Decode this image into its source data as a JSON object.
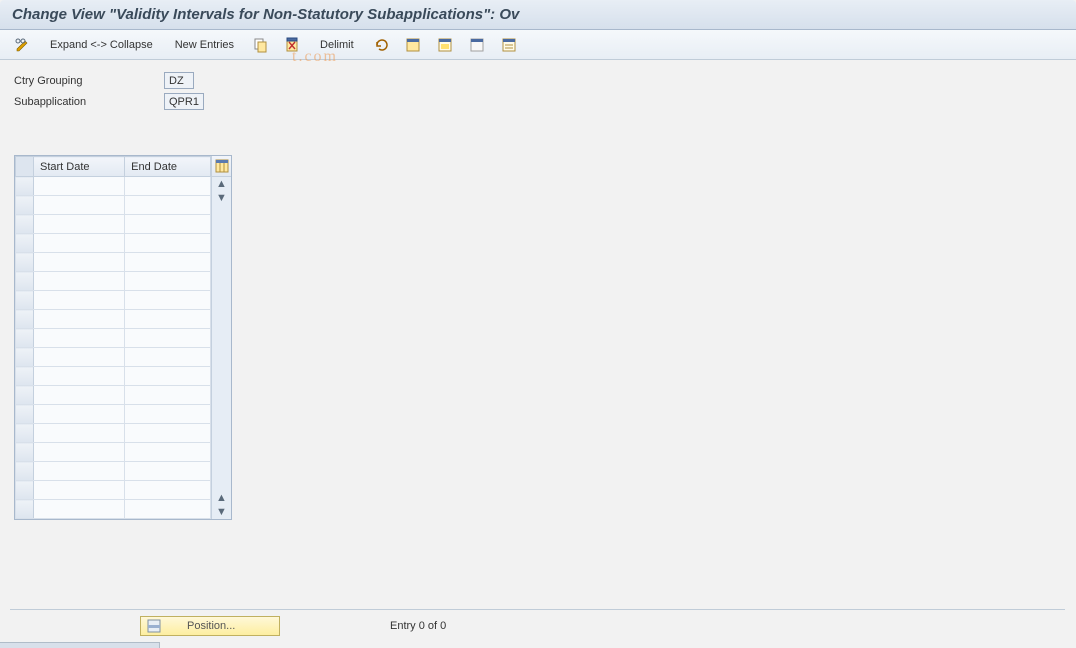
{
  "title": "Change View \"Validity Intervals for Non-Statutory Subapplications\": Ov",
  "watermark": "t.com",
  "toolbar": {
    "expand_collapse": "Expand <-> Collapse",
    "new_entries": "New Entries",
    "delimit": "Delimit"
  },
  "form": {
    "ctry_grouping_label": "Ctry Grouping",
    "ctry_grouping_value": "DZ",
    "subapplication_label": "Subapplication",
    "subapplication_value": "QPR1"
  },
  "table": {
    "columns": [
      "Start Date",
      "End Date"
    ],
    "rows": [
      {
        "start": "",
        "end": ""
      },
      {
        "start": "",
        "end": ""
      },
      {
        "start": "",
        "end": ""
      },
      {
        "start": "",
        "end": ""
      },
      {
        "start": "",
        "end": ""
      },
      {
        "start": "",
        "end": ""
      },
      {
        "start": "",
        "end": ""
      },
      {
        "start": "",
        "end": ""
      },
      {
        "start": "",
        "end": ""
      },
      {
        "start": "",
        "end": ""
      },
      {
        "start": "",
        "end": ""
      },
      {
        "start": "",
        "end": ""
      },
      {
        "start": "",
        "end": ""
      },
      {
        "start": "",
        "end": ""
      },
      {
        "start": "",
        "end": ""
      },
      {
        "start": "",
        "end": ""
      },
      {
        "start": "",
        "end": ""
      },
      {
        "start": "",
        "end": ""
      }
    ]
  },
  "footer": {
    "position_label": "Position...",
    "entry_text": "Entry 0 of 0"
  }
}
